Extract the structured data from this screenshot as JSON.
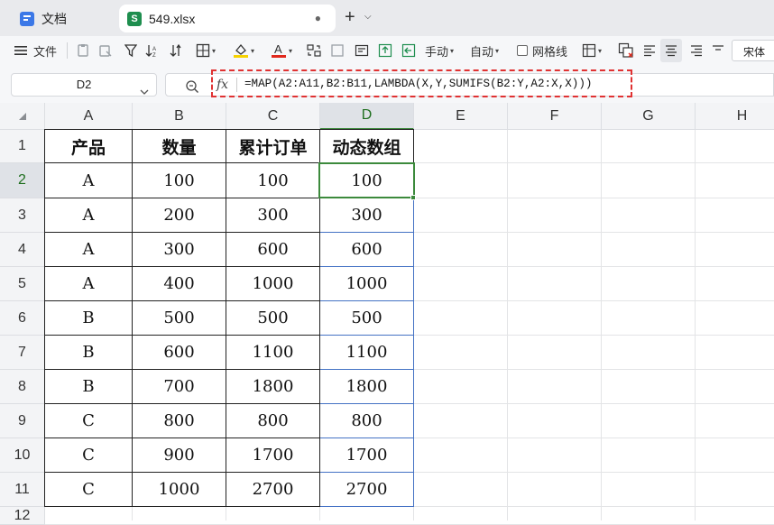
{
  "tabs": [
    {
      "label": "文档",
      "icon": "docs-app-icon"
    },
    {
      "label": "549.xlsx",
      "icon": "spreadsheet-icon",
      "icon_glyph": "S",
      "active": true
    }
  ],
  "toolbar": {
    "file_label": "文件",
    "wrap_mode_label": "手动",
    "autofit_label": "自动",
    "gridlines_label": "网格线",
    "font_name": "宋体"
  },
  "formula_bar": {
    "name_box": "D2",
    "fx_label": "fx",
    "formula": "=MAP(A2:A11,B2:B11,LAMBDA(X,Y,SUMIFS(B2:Y,A2:X,X)))"
  },
  "sheet": {
    "columns": [
      "A",
      "B",
      "C",
      "D",
      "E",
      "F",
      "G",
      "H"
    ],
    "selected_column": "D",
    "rows": [
      "1",
      "2",
      "3",
      "4",
      "5",
      "6",
      "7",
      "8",
      "9",
      "10",
      "11",
      "12"
    ],
    "selected_row": "2",
    "header": [
      "产品",
      "数量",
      "累计订单",
      "动态数组"
    ],
    "data": [
      [
        "A",
        "100",
        "100",
        "100"
      ],
      [
        "A",
        "200",
        "300",
        "300"
      ],
      [
        "A",
        "300",
        "600",
        "600"
      ],
      [
        "A",
        "400",
        "1000",
        "1000"
      ],
      [
        "B",
        "500",
        "500",
        "500"
      ],
      [
        "B",
        "600",
        "1100",
        "1100"
      ],
      [
        "B",
        "700",
        "1800",
        "1800"
      ],
      [
        "C",
        "800",
        "800",
        "800"
      ],
      [
        "C",
        "900",
        "1700",
        "1700"
      ],
      [
        "C",
        "1000",
        "2700",
        "2700"
      ]
    ]
  },
  "colors": {
    "active_cell_border": "#3c8a3c",
    "spill_range_border": "#4472c4",
    "formula_highlight": "#e03232",
    "spreadsheet_icon": "#1e8e4e",
    "docs_icon": "#3b78e7"
  }
}
